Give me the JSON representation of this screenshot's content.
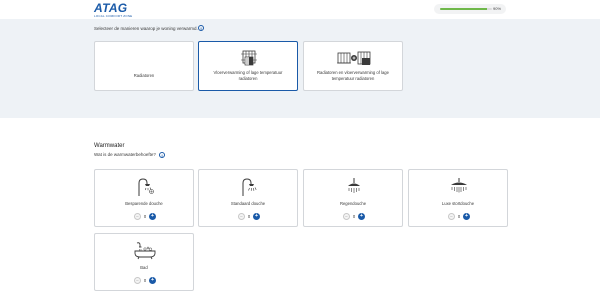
{
  "header": {
    "logo": {
      "word": "ATAG",
      "tagline": "LOCAL COMFORT ZONE"
    },
    "progress": {
      "percent": 90,
      "label": "90%"
    }
  },
  "heating": {
    "prompt": "Selecteer de manieren waarop je woning verwarmd.",
    "info_icon": "info-icon",
    "options": [
      {
        "label": "Radiatoren",
        "icon": "radiator-icon",
        "selected": false
      },
      {
        "label": "Vloerverwarming of lage temperatuur radiatoren",
        "icon": "floor-heating-icon",
        "selected": true
      },
      {
        "label": "Radiatoren en vloerverwarming of lage temperatuur radiatoren",
        "icon": "radiator-plus-floor-heating-icon",
        "selected": false
      }
    ]
  },
  "warmwater": {
    "title": "Warmwater",
    "prompt": "Wat is de warmwaterbehoefte?",
    "info_icon": "info-icon",
    "options": [
      {
        "label": "Besparende douche",
        "icon": "eco-shower-icon",
        "count": "0"
      },
      {
        "label": "Standaard douche",
        "icon": "standard-shower-icon",
        "count": "0"
      },
      {
        "label": "Regendouche",
        "icon": "rain-shower-icon",
        "count": "0"
      },
      {
        "label": "Luxe stortdouche",
        "icon": "luxury-shower-icon",
        "count": "0"
      },
      {
        "label": "Bad",
        "icon": "bath-icon",
        "count": "0"
      }
    ],
    "minus_symbol": "−",
    "plus_symbol": "+"
  },
  "colors": {
    "brand": "#1a5aa8",
    "progress": "#6fb84a",
    "section_bg": "#eef2f6"
  }
}
